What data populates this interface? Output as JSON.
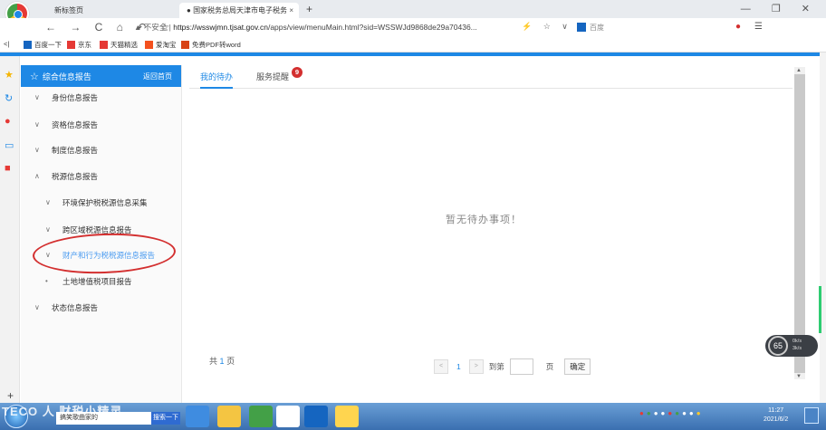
{
  "browser": {
    "tabs": [
      {
        "title": "新标签页"
      },
      {
        "title": "国家税务总局天津市电子税务局",
        "close": "×"
      }
    ],
    "new_tab": "+",
    "window_controls": "— ❐ ✕",
    "nav_buttons": "← → C ⌂ ↶ ☆",
    "security_label": "▲ 不安全 |",
    "url_host": "https://wsswjmn.tjsat.gov.cn",
    "url_path": "/apps/view/menuMain.html?sid=WSSWJd9868de29a70436...",
    "nav_right": "⚡ ☆ ∨",
    "search_placeholder": "百度",
    "bookmarks": [
      "百度一下",
      "京东",
      "天猫精选",
      "爱淘宝",
      "免费PDF转word"
    ],
    "bookmark_back": "<|"
  },
  "sidebar": {
    "header": "综合信息报告",
    "back_link": "返回首页",
    "items": [
      {
        "label": "身份信息报告",
        "chevron": "∨"
      },
      {
        "label": "资格信息报告",
        "chevron": "∨"
      },
      {
        "label": "制度信息报告",
        "chevron": "∨"
      },
      {
        "label": "税源信息报告",
        "chevron": "∧"
      },
      {
        "label": "环境保护税税源信息采集",
        "chevron": "∨"
      },
      {
        "label": "跨区域税源信息报告",
        "chevron": "∨"
      },
      {
        "label": "财产和行为税税源信息报告",
        "chevron": "∨"
      },
      {
        "label": "土地增值税项目报告",
        "chevron": "•"
      },
      {
        "label": "状态信息报告",
        "chevron": "∨"
      }
    ]
  },
  "main": {
    "tabs": [
      {
        "label": "我的待办"
      },
      {
        "label": "服务提醒",
        "badge": "9"
      }
    ],
    "empty_message": "暂无待办事项！",
    "total_prefix": "共",
    "total_count": "1",
    "total_suffix": "页",
    "pager": {
      "prev": "<",
      "current": "1",
      "next": ">",
      "goto_label": "到第",
      "page_label": "页",
      "confirm": "确定"
    }
  },
  "speed_widget": {
    "percent": "65",
    "up": "0k/s",
    "down": "3k/s"
  },
  "taskbar": {
    "watermark": "TECO 人 财税小精灵",
    "search_text": "搞笑歌曲家的",
    "search_button": "搜索一下",
    "clock_time": "11:27",
    "clock_date": "2021/6/2"
  },
  "colors": {
    "accent": "#1e88e5",
    "active_menu": "#4a9bf0",
    "badge": "#d32f2f",
    "annotation": "#d32f2f"
  }
}
